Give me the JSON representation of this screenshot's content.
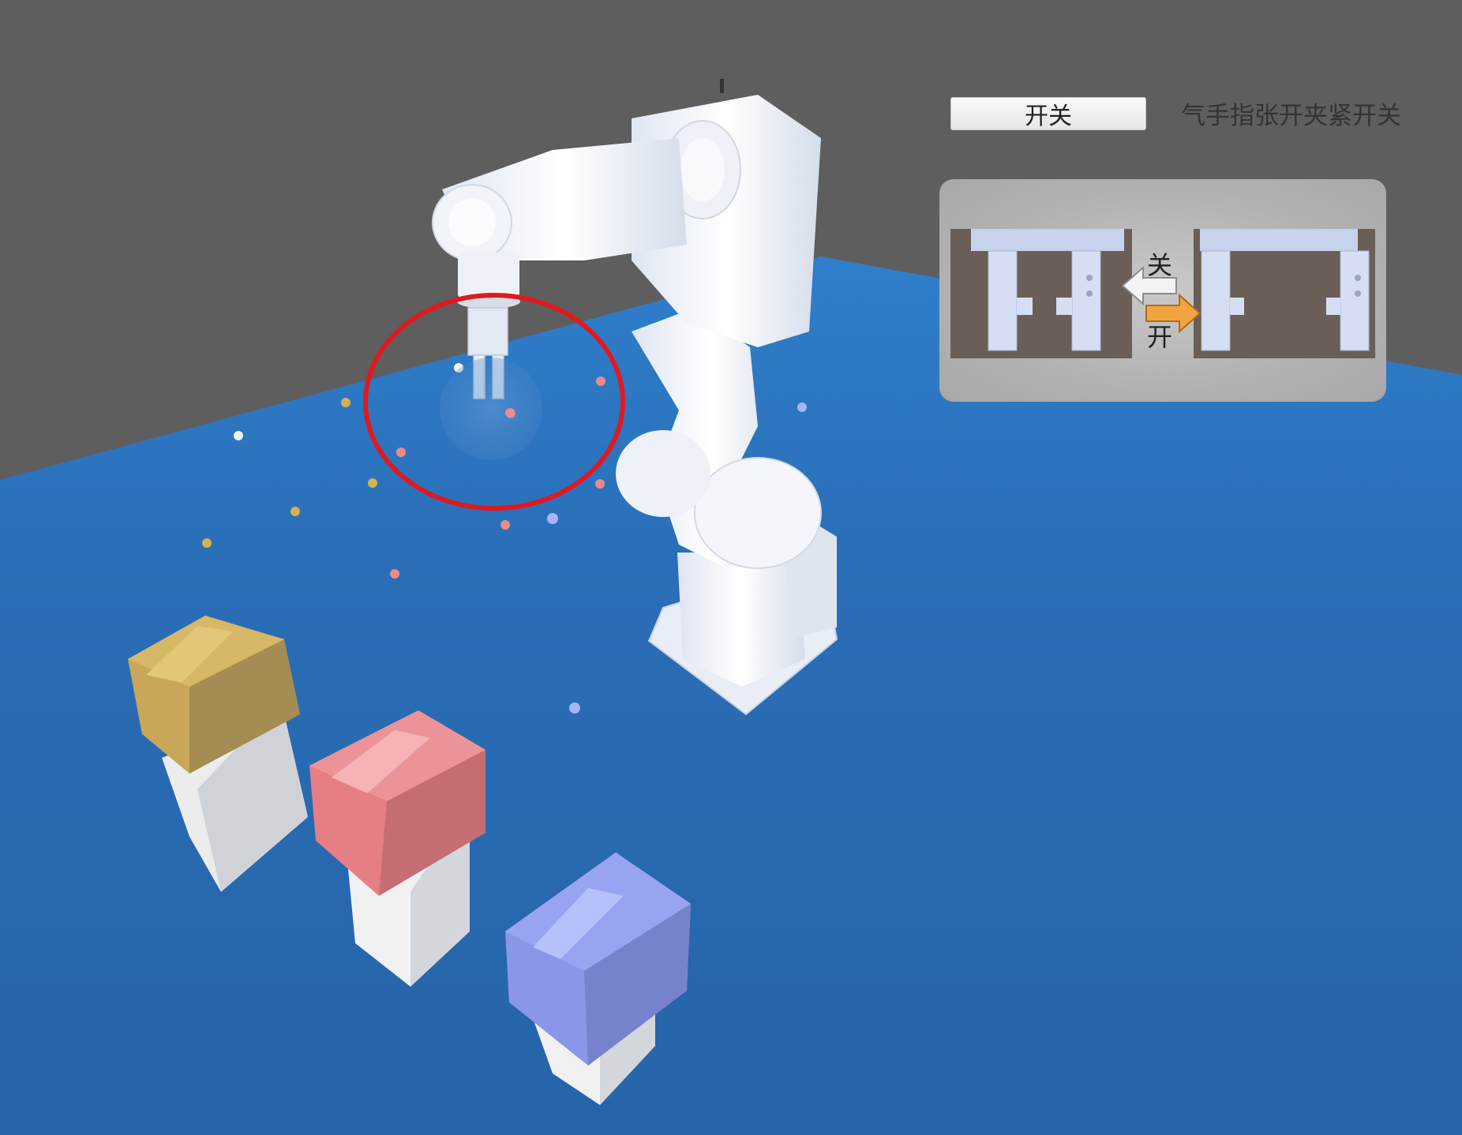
{
  "controls": {
    "toggle_button_label": "开关",
    "caption": "气手指张开夹紧开关"
  },
  "gripper_diagram": {
    "close_label": "关",
    "open_label": "开"
  },
  "colors": {
    "background": "#5e5e5e",
    "floor": "#2866ae",
    "highlight_circle": "#e0191f",
    "block_yellow": "#c9a75a",
    "block_red": "#e57f85",
    "block_blue": "#8a96e8"
  }
}
